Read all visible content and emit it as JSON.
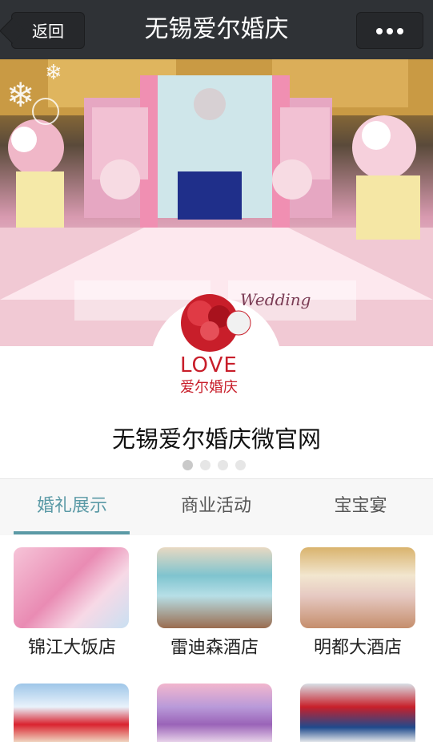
{
  "nav": {
    "back_label": "返回",
    "title": "无锡爱尔婚庆"
  },
  "hero": {
    "logo_word": "LOVE",
    "logo_sub": "爱尔婚庆",
    "wedding_text": "Wedding",
    "page_count": 4,
    "active_page": 1
  },
  "site_title": "无锡爱尔婚庆微官网",
  "tabs": [
    "婚礼展示",
    "商业活动",
    "宝宝宴"
  ],
  "active_tab": 0,
  "grid": [
    {
      "label": "锦江大饭店"
    },
    {
      "label": "雷迪森酒店"
    },
    {
      "label": "明都大酒店"
    },
    {
      "label": ""
    },
    {
      "label": ""
    },
    {
      "label": ""
    }
  ]
}
